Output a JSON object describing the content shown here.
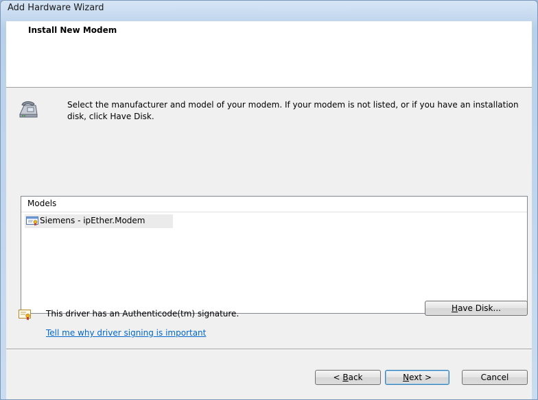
{
  "window": {
    "title": "Add Hardware Wizard"
  },
  "header": {
    "title": "Install New Modem"
  },
  "instructions": "Select the manufacturer and model of your modem. If your modem is not listed, or if you have an installation disk, click Have Disk.",
  "models": {
    "header": "Models",
    "items": [
      {
        "label": "Siemens - ipEther.Modem",
        "selected": true
      }
    ]
  },
  "signature": {
    "text": "This driver has an Authenticode(tm) signature.",
    "link": "Tell me why driver signing is important"
  },
  "buttons": {
    "have_disk": {
      "label": "Have Disk...",
      "mnemonic": "H",
      "rest": "ave Disk..."
    },
    "back": {
      "prefix": "< ",
      "mnemonic": "B",
      "rest": "ack"
    },
    "next": {
      "mnemonic": "N",
      "rest": "ext >"
    },
    "cancel": "Cancel"
  },
  "icons": {
    "modem": "modem-icon",
    "certificate": "certificate-icon",
    "model_item": "certificate-icon"
  },
  "colors": {
    "link": "#0066cc",
    "title_bar": "#b9d0ea",
    "dialog_bg": "#f0f0f0"
  }
}
